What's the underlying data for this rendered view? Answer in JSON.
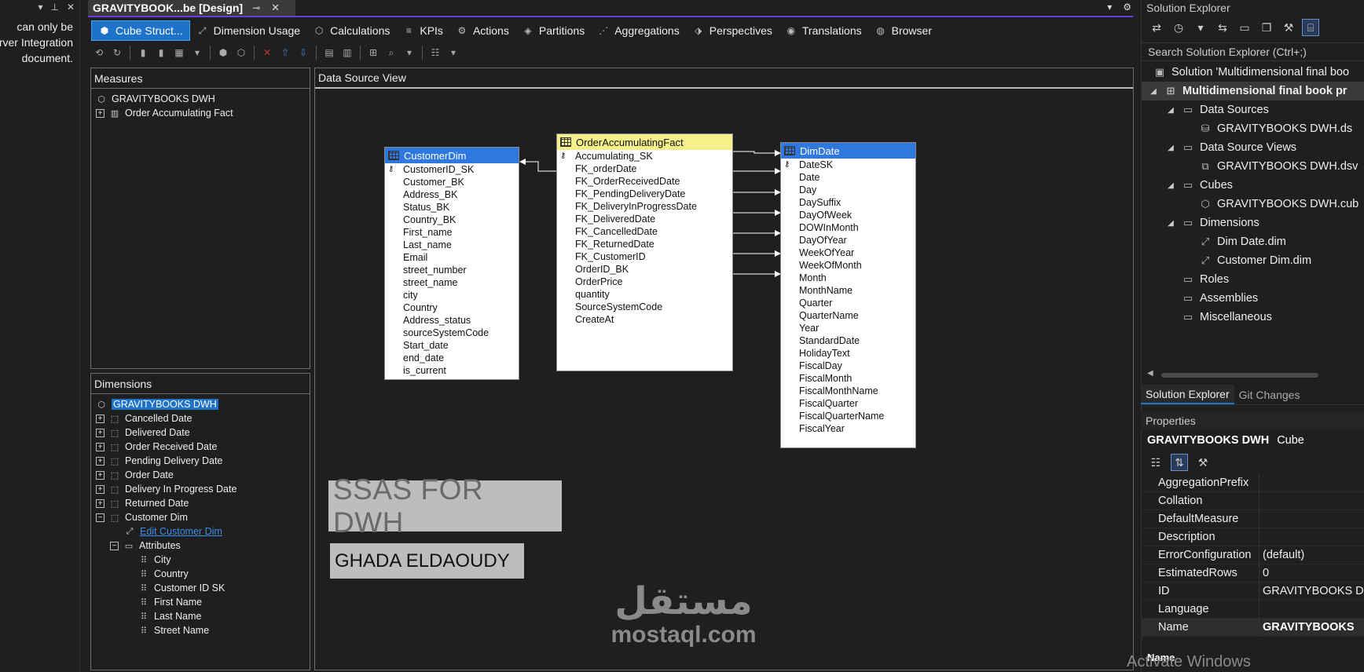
{
  "left_strip": {
    "message_lines": [
      "can only be",
      "erver Integration",
      "document."
    ]
  },
  "doc_tab": {
    "title": "GRAVITYBOOK...be [Design]"
  },
  "designer_tabs": [
    {
      "label": "Cube Struct...",
      "icon": "cube-structure-icon",
      "active": true
    },
    {
      "label": "Dimension Usage",
      "icon": "dimension-usage-icon"
    },
    {
      "label": "Calculations",
      "icon": "calculations-icon"
    },
    {
      "label": "KPIs",
      "icon": "kpis-icon"
    },
    {
      "label": "Actions",
      "icon": "actions-icon"
    },
    {
      "label": "Partitions",
      "icon": "partitions-icon"
    },
    {
      "label": "Aggregations",
      "icon": "aggregations-icon"
    },
    {
      "label": "Perspectives",
      "icon": "perspectives-icon"
    },
    {
      "label": "Translations",
      "icon": "translations-icon"
    },
    {
      "label": "Browser",
      "icon": "browser-icon"
    }
  ],
  "measures": {
    "header": "Measures",
    "root": "GRAVITYBOOKS DWH",
    "groups": [
      "Order Accumulating Fact"
    ]
  },
  "dimensions": {
    "header": "Dimensions",
    "root": "GRAVITYBOOKS DWH",
    "items": [
      "Cancelled Date",
      "Delivered Date",
      "Order Received Date",
      "Pending Delivery Date",
      "Order Date",
      "Delivery In Progress Date",
      "Returned Date",
      "Customer Dim"
    ],
    "edit_link": "Edit Customer Dim",
    "attributes_label": "Attributes",
    "attributes": [
      "City",
      "Country",
      "Customer ID SK",
      "First Name",
      "Last Name",
      "Street Name"
    ]
  },
  "dsv": {
    "header": "Data Source View",
    "tables": [
      {
        "name": "CustomerDim",
        "key": "CustomerID_SK",
        "columns": [
          "Customer_BK",
          "Address_BK",
          "Status_BK",
          "Country_BK",
          "First_name",
          "Last_name",
          "Email",
          "street_number",
          "street_name",
          "city",
          "Country",
          "Address_status",
          "sourceSystemCode",
          "Start_date",
          "end_date",
          "is_current"
        ]
      },
      {
        "name": "OrderAccumulatingFact",
        "key": "Accumulating_SK",
        "columns": [
          "FK_orderDate",
          "FK_OrderReceivedDate",
          "FK_PendingDeliveryDate",
          "FK_DeliveryInProgressDate",
          "FK_DeliveredDate",
          "FK_CancelledDate",
          "FK_ReturnedDate",
          "FK_CustomerID",
          "OrderID_BK",
          "OrderPrice",
          "quantity",
          "SourceSystemCode",
          "CreateAt"
        ]
      },
      {
        "name": "DimDate",
        "key": "DateSK",
        "columns": [
          "Date",
          "Day",
          "DaySuffix",
          "DayOfWeek",
          "DOWInMonth",
          "DayOfYear",
          "WeekOfYear",
          "WeekOfMonth",
          "Month",
          "MonthName",
          "Quarter",
          "QuarterName",
          "Year",
          "StandardDate",
          "HolidayText",
          "FiscalDay",
          "FiscalMonth",
          "FiscalMonthName",
          "FiscalQuarter",
          "FiscalQuarterName",
          "FiscalYear"
        ]
      }
    ],
    "overlay_title": "SSAS FOR DWH",
    "overlay_author": "GHADA ELDAOUDY",
    "watermark_ar": "مستقل",
    "watermark_lat": "mostaql.com"
  },
  "solution_explorer": {
    "title": "Solution Explorer",
    "search_placeholder": "Search Solution Explorer (Ctrl+;)",
    "solution": "Solution 'Multidimensional final boo",
    "project": "Multidimensional final book pr",
    "nodes": {
      "data_sources": "Data Sources",
      "ds_file": "GRAVITYBOOKS DWH.ds",
      "dsv": "Data Source Views",
      "dsv_file": "GRAVITYBOOKS DWH.dsv",
      "cubes": "Cubes",
      "cube_file": "GRAVITYBOOKS DWH.cub",
      "dimensions": "Dimensions",
      "dim1": "Dim Date.dim",
      "dim2": "Customer Dim.dim",
      "roles": "Roles",
      "assemblies": "Assemblies",
      "misc": "Miscellaneous"
    },
    "bottom_tabs": [
      "Solution Explorer",
      "Git Changes"
    ]
  },
  "properties": {
    "title": "Properties",
    "object_name": "GRAVITYBOOKS DWH",
    "object_type": "Cube",
    "rows": [
      {
        "name": "AggregationPrefix",
        "value": ""
      },
      {
        "name": "Collation",
        "value": ""
      },
      {
        "name": "DefaultMeasure",
        "value": ""
      },
      {
        "name": "Description",
        "value": ""
      },
      {
        "name": "ErrorConfiguration",
        "value": "(default)"
      },
      {
        "name": "EstimatedRows",
        "value": "0"
      },
      {
        "name": "ID",
        "value": "GRAVITYBOOKS D"
      },
      {
        "name": "Language",
        "value": ""
      },
      {
        "name": "Name",
        "value": "GRAVITYBOOKS"
      }
    ],
    "desc_label": "Name"
  },
  "activate_text": "Activate Windows"
}
